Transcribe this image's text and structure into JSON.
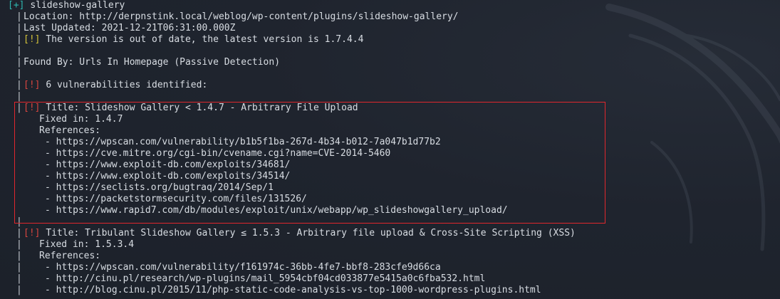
{
  "header": {
    "marker": "[+]",
    "plugin_name": "slideshow-gallery"
  },
  "info": {
    "location_label": "Location:",
    "location_value": "http://derpnstink.local/weblog/wp-content/plugins/slideshow-gallery/",
    "updated_label": "Last Updated:",
    "updated_value": "2021-12-21T06:31:00.000Z",
    "warn_marker": "[!]",
    "outdated_text": "The version is out of date, the latest version is 1.7.4.4",
    "found_by": "Found By: Urls In Homepage (Passive Detection)"
  },
  "vuln_summary": {
    "marker": "[!]",
    "text": "6 vulnerabilities identified:"
  },
  "vulnerabilities": [
    {
      "marker": "[!]",
      "title": "Title: Slideshow Gallery < 1.4.7 - Arbitrary File Upload",
      "fixed_in": "Fixed in: 1.4.7",
      "references_label": "References:",
      "references": [
        "- https://wpscan.com/vulnerability/b1b5f1ba-267d-4b34-b012-7a047b1d77b2",
        "- https://cve.mitre.org/cgi-bin/cvename.cgi?name=CVE-2014-5460",
        "- https://www.exploit-db.com/exploits/34681/",
        "- https://www.exploit-db.com/exploits/34514/",
        "- https://seclists.org/bugtraq/2014/Sep/1",
        "- https://packetstormsecurity.com/files/131526/",
        "- https://www.rapid7.com/db/modules/exploit/unix/webapp/wp_slideshowgallery_upload/"
      ]
    },
    {
      "marker": "[!]",
      "title": "Title: Tribulant Slideshow Gallery ≤ 1.5.3 - Arbitrary file upload & Cross-Site Scripting (XSS)",
      "fixed_in": "Fixed in: 1.5.3.4",
      "references_label": "References:",
      "references": [
        "- https://wpscan.com/vulnerability/f161974c-36bb-4fe7-bbf8-283cfe9d66ca",
        "- http://cinu.pl/research/wp-plugins/mail_5954cbf04cd033877e5415a0c6fba532.html",
        "- http://blog.cinu.pl/2015/11/php-static-code-analysis-vs-top-1000-wordpress-plugins.html"
      ]
    }
  ],
  "pipe_char": "|",
  "colors": {
    "background": "#1f242e",
    "text": "#d8dde3",
    "plus_marker": "#2fb7b0",
    "warning_marker": "#d4c33a",
    "error_marker": "#d8453f",
    "highlight_box": "#e0272d"
  },
  "icons": {
    "watermark": "kali-dragon-icon"
  }
}
